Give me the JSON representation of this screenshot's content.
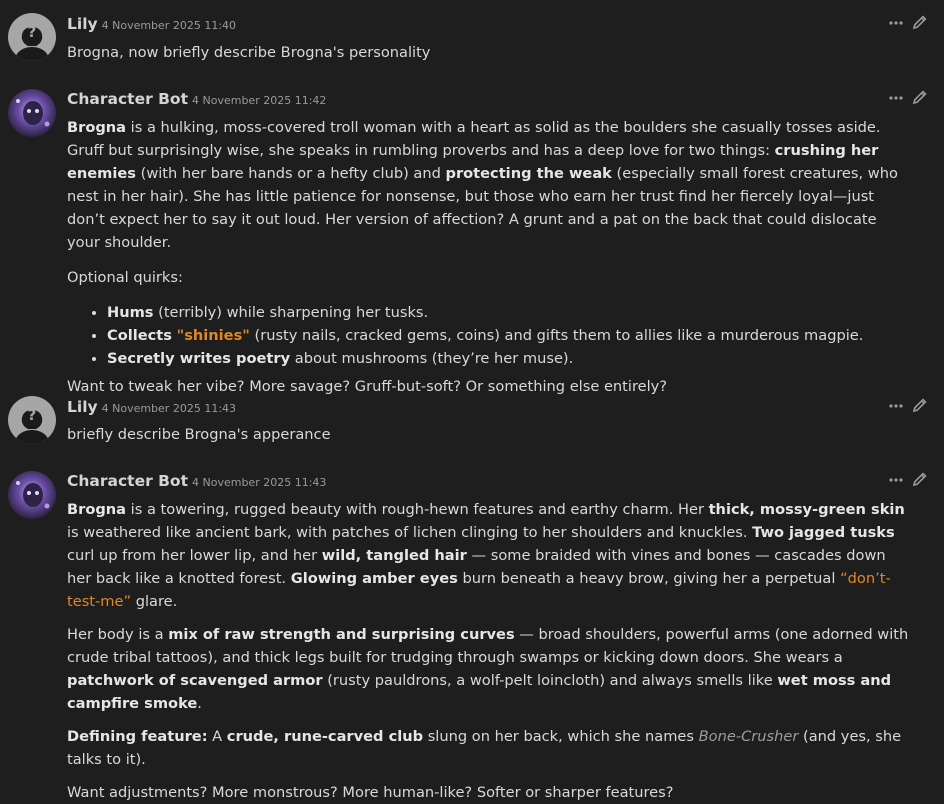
{
  "messages": [
    {
      "author": "Lily",
      "time": "4 November 2025 11:40",
      "text": "Brogna, now briefly describe Brogna's personality"
    },
    {
      "author": "Character Bot",
      "time": "4 November 2025 11:42",
      "p1": {
        "a": "Brogna",
        "b": " is a hulking, moss-covered troll woman with a heart as solid as the boulders she casually tosses aside. Gruff but surprisingly wise, she speaks in rumbling proverbs and has a deep love for two things: ",
        "c": "crushing her enemies",
        "d": " (with her bare hands or a hefty club) and ",
        "e": "protecting the weak",
        "f": " (especially small forest creatures, who nest in her hair). She has little patience for nonsense, but those who earn her trust find her fiercely loyal—just don’t expect her to say it out loud. Her version of affection? A grunt and a pat on the back that could dislocate your shoulder."
      },
      "p2": "Optional quirks:",
      "quirks": [
        {
          "bold": "Hums",
          "rest": " (terribly) while sharpening her tusks."
        },
        {
          "bold": "Collects",
          "space": " ",
          "highlight": "\"shinies\"",
          "rest": " (rusty nails, cracked gems, coins) and gifts them to allies like a murderous magpie."
        },
        {
          "bold": "Secretly writes poetry",
          "rest": " about mushrooms (they’re her muse)."
        }
      ],
      "p3": "Want to tweak her vibe? More savage? Gruff-but-soft? Or something else entirely?"
    },
    {
      "author": "Lily",
      "time": "4 November 2025 11:43",
      "text": "briefly describe Brogna's apperance"
    },
    {
      "author": "Character Bot",
      "time": "4 November 2025 11:43",
      "p1": {
        "a": "Brogna",
        "b": " is a towering, rugged beauty with rough-hewn features and earthy charm. Her ",
        "c": "thick, mossy-green skin",
        "d": " is weathered like ancient bark, with patches of lichen clinging to her shoulders and knuckles. ",
        "e": "Two jagged tusks",
        "f": " curl up from her lower lip, and her ",
        "g": "wild, tangled hair",
        "h": " — some braided with vines and bones — cascades down her back like a knotted forest. ",
        "i": "Glowing amber eyes",
        "j": " burn beneath a heavy brow, giving her a perpetual ",
        "k": "“don’t-test-me”",
        "l": " glare."
      },
      "p2": {
        "a": "Her body is a ",
        "b": "mix of raw strength and surprising curves",
        "c": " — broad shoulders, powerful arms (one adorned with crude tribal tattoos), and thick legs built for trudging through swamps or kicking down doors. She wears a ",
        "d": "patchwork of scavenged armor",
        "e": " (rusty pauldrons, a wolf-pelt loincloth) and always smells like ",
        "f": "wet moss and campfire smoke",
        "g": "."
      },
      "p3": {
        "a": "Defining feature:",
        "b": " A ",
        "c": "crude, rune-carved club",
        "d": " slung on her back, which she names ",
        "e": "Bone-Crusher",
        "f": " (and yes, she talks to it)."
      },
      "p4": "Want adjustments? More monstrous? More human-like? Softer or sharper features?"
    }
  ]
}
